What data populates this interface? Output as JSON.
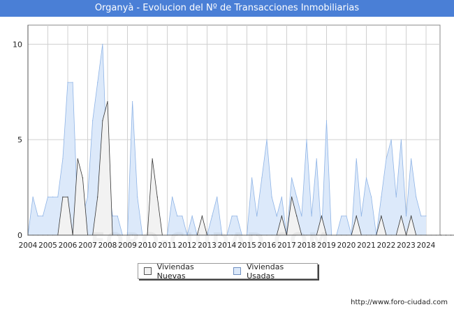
{
  "title": "Organyà - Evolucion del Nº de Transacciones Inmobiliarias",
  "footer_url": "http://www.foro-ciudad.com",
  "watermark": "FORO-CIUDAD.COM",
  "colors": {
    "title_bg": "#4a7fd6",
    "nuevas_fill": "#f2f2f2",
    "nuevas_line": "#333333",
    "usadas_fill": "#dce9fa",
    "usadas_line": "#8fb4e6",
    "grid": "#d0d0d0"
  },
  "chart_data": {
    "type": "area",
    "x_unit": "quarter",
    "x_start_label": "2004",
    "x_tick_labels": [
      "2004",
      "2005",
      "2006",
      "2007",
      "2008",
      "2009",
      "2010",
      "2011",
      "2012",
      "2013",
      "2014",
      "2015",
      "2016",
      "2017",
      "2018",
      "2019",
      "2020",
      "2021",
      "2022",
      "2023",
      "2024"
    ],
    "y_ticks": [
      0,
      5,
      10
    ],
    "ylim": [
      0,
      11
    ],
    "grid": true,
    "legend_position": "bottom-center",
    "series": [
      {
        "name": "Viviendas Nuevas",
        "values": [
          0,
          0,
          0,
          0,
          0,
          0,
          0,
          2,
          2,
          0,
          4,
          3,
          0,
          0,
          2,
          6,
          7,
          0,
          0,
          0,
          0,
          0,
          0,
          0,
          0,
          4,
          2,
          0,
          0,
          0,
          0,
          0,
          0,
          0,
          0,
          1,
          0,
          0,
          0,
          0,
          0,
          0,
          0,
          0,
          0,
          0,
          0,
          0,
          0,
          0,
          0,
          1,
          0,
          2,
          1,
          0,
          0,
          0,
          0,
          1,
          0,
          0,
          0,
          0,
          0,
          0,
          1,
          0,
          0,
          0,
          0,
          1,
          0,
          0,
          0,
          1,
          0,
          1,
          0,
          0,
          0,
          0,
          0,
          0,
          0,
          0,
          0,
          0,
          0,
          0,
          0,
          0,
          0,
          0,
          0,
          0
        ]
      },
      {
        "name": "Viviendas Usadas",
        "values": [
          0,
          2,
          1,
          1,
          2,
          2,
          2,
          4,
          8,
          8,
          1,
          1,
          2,
          6,
          8,
          10,
          3,
          1,
          1,
          0,
          0,
          7,
          2,
          0,
          0,
          0,
          0,
          0,
          0,
          2,
          1,
          1,
          0,
          1,
          0,
          0,
          0,
          1,
          2,
          0,
          0,
          1,
          1,
          0,
          0,
          3,
          1,
          3,
          5,
          2,
          1,
          2,
          0,
          3,
          2,
          1,
          5,
          1,
          4,
          0,
          6,
          0,
          0,
          1,
          1,
          0,
          4,
          1,
          3,
          2,
          0,
          2,
          4,
          5,
          2,
          5,
          1,
          4,
          2,
          1,
          1
        ]
      }
    ]
  }
}
